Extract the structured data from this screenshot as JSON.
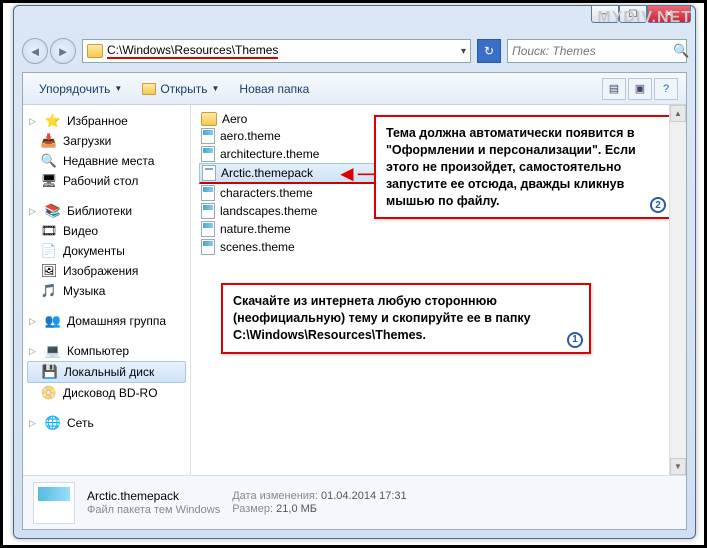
{
  "watermark": "MYDIV.NET",
  "window": {
    "min": "─",
    "max": "☐",
    "close": "✕"
  },
  "address": {
    "path": "C:\\Windows\\Resources\\Themes",
    "dropdown": "▾"
  },
  "search": {
    "placeholder": "Поиск: Themes"
  },
  "toolbar": {
    "organize": "Упорядочить",
    "open": "Открыть",
    "newfolder": "Новая папка"
  },
  "sidebar": {
    "favorites": {
      "label": "Избранное",
      "items": [
        "Загрузки",
        "Недавние места",
        "Рабочий стол"
      ]
    },
    "libraries": {
      "label": "Библиотеки",
      "items": [
        "Видео",
        "Документы",
        "Изображения",
        "Музыка"
      ]
    },
    "homegroup": {
      "label": "Домашняя группа"
    },
    "computer": {
      "label": "Компьютер",
      "items": [
        "Локальный диск",
        "Дисковод BD-RO"
      ]
    },
    "network": {
      "label": "Сеть"
    }
  },
  "files": {
    "items": [
      {
        "name": "Aero",
        "type": "folder"
      },
      {
        "name": "aero.theme",
        "type": "theme"
      },
      {
        "name": "architecture.theme",
        "type": "theme"
      },
      {
        "name": "Arctic.themepack",
        "type": "themepack",
        "selected": true
      },
      {
        "name": "characters.theme",
        "type": "theme"
      },
      {
        "name": "landscapes.theme",
        "type": "theme"
      },
      {
        "name": "nature.theme",
        "type": "theme"
      },
      {
        "name": "scenes.theme",
        "type": "theme"
      }
    ]
  },
  "annot": {
    "box1": "Тема должна автоматически появится в \"Оформлении и персонализации\". Если этого не произойдет, самостоятельно запустите ее отсюда, дважды кликнув мышью по файлу.",
    "num1": "2",
    "box2": "Скачайте из интернета любую стороннюю (неофициальную) тему и скопируйте ее в папку C:\\Windows\\Resources\\Themes.",
    "num2": "1"
  },
  "details": {
    "name": "Arctic.themepack",
    "type": "Файл пакета тем Windows",
    "date_label": "Дата изменения:",
    "date": "01.04.2014 17:31",
    "size_label": "Размер:",
    "size": "21,0 МБ"
  }
}
